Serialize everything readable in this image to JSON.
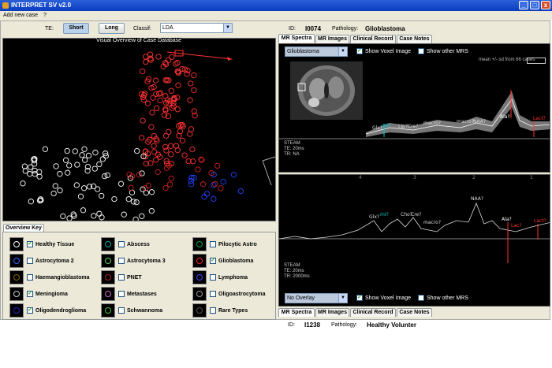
{
  "window": {
    "title": "INTERPRET SV v2.0",
    "buttons": [
      "_",
      "□",
      "x"
    ]
  },
  "menu": [
    "Add new case",
    "?"
  ],
  "toolbar": {
    "te_label": "TE:",
    "short_label": "Short",
    "long_label": "Long",
    "classif_label": "Classif:",
    "classif_value": "LDA"
  },
  "overview": {
    "title": "Visual Overview of Case Database"
  },
  "top_case": {
    "tabs": [
      "MR Spectra",
      "MR Images",
      "Clinical Record",
      "Case Notes"
    ],
    "id_label": "ID:",
    "id_value": "I0074",
    "pathology_label": "Pathology:",
    "pathology_value": "Glioblastoma",
    "overlay_value": "Glioblastoma",
    "show_voxel": "Show Voxel Image",
    "show_other": "Show other MRS",
    "mean_note": "mean +/- sd from 66 cases",
    "params": [
      "STEAM",
      "TE: 20ms",
      "TR: NA"
    ],
    "peaks": [
      "Glx?",
      "mI?",
      "Lip?",
      "Cre?",
      "macro?",
      "macro?",
      "NAA?",
      "Ala?",
      "Lact?"
    ],
    "axis": [
      "4",
      "3",
      "2",
      "1"
    ]
  },
  "bottom_case": {
    "tabs": [
      "MR Spectra",
      "MR Images",
      "Clinical Record",
      "Case Notes"
    ],
    "id_label": "ID:",
    "id_value": "I1238",
    "pathology_label": "Pathology:",
    "pathology_value": "Healthy Volunter",
    "overlay_value": "No Overlay",
    "show_voxel": "Show Voxel Image",
    "show_other": "Show other MRS",
    "params": [
      "STEAM",
      "TE: 20ms",
      "TR: 2000ms"
    ],
    "peaks": [
      "Glx?",
      "mI?",
      "Cho?",
      "Cre?",
      "macro?",
      "NAA?",
      "Ala?",
      "Lac?",
      "Lact?"
    ],
    "axis": [
      "4",
      "3",
      "2",
      "1"
    ]
  },
  "overview_key": {
    "tab": "Overview Key",
    "items": [
      {
        "label": "Healthy Tissue",
        "checked": true,
        "color": "#ffffff"
      },
      {
        "label": "Abscess",
        "checked": false,
        "color": "#00aaaa"
      },
      {
        "label": "Pilocytic Astro",
        "checked": false,
        "color": "#00aa44"
      },
      {
        "label": "Astrocytoma 2",
        "checked": false,
        "color": "#3366ff"
      },
      {
        "label": "Astrocytoma 3",
        "checked": false,
        "color": "#66cc66"
      },
      {
        "label": "Glioblastoma",
        "checked": true,
        "color": "#ff2222"
      },
      {
        "label": "Haemangioblastoma",
        "checked": false,
        "color": "#886600"
      },
      {
        "label": "PNET",
        "checked": false,
        "color": "#aa2222"
      },
      {
        "label": "Lymphoma",
        "checked": false,
        "color": "#4444ff"
      },
      {
        "label": "Meningioma",
        "checked": true,
        "color": "#cccccc"
      },
      {
        "label": "Metastases",
        "checked": false,
        "color": "#cc66cc"
      },
      {
        "label": "Oligoastrocytoma",
        "checked": false,
        "color": "#999999"
      },
      {
        "label": "Oligodendroglioma",
        "checked": true,
        "color": "#2222cc"
      },
      {
        "label": "Schwannoma",
        "checked": false,
        "color": "#33cc33"
      },
      {
        "label": "Rare Types",
        "checked": false,
        "color": "#555555"
      }
    ]
  }
}
